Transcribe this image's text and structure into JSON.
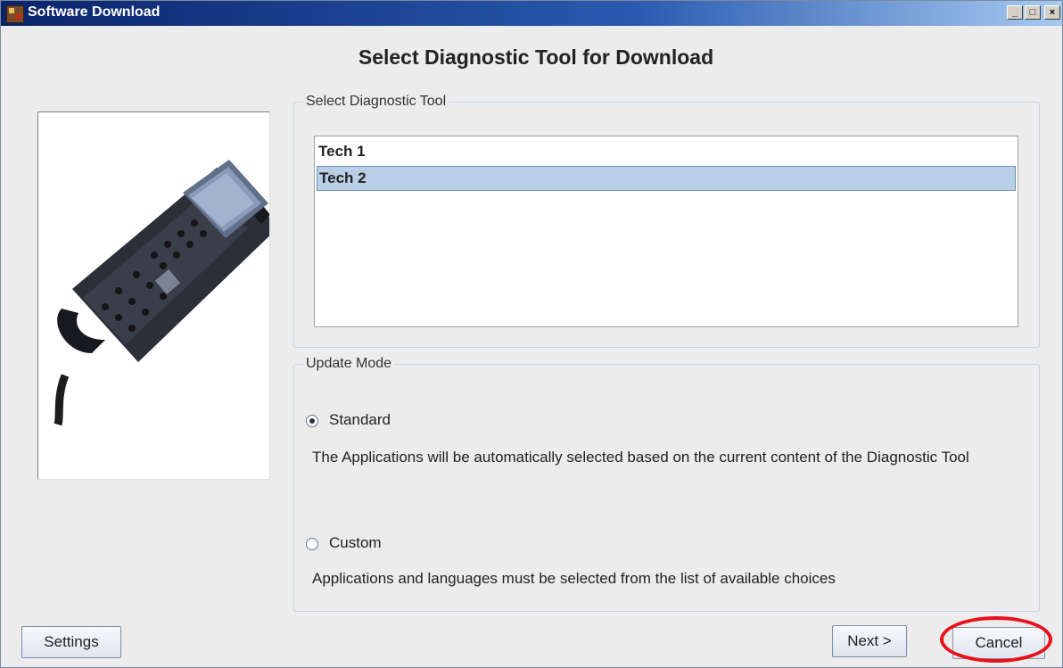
{
  "window": {
    "title": "Software Download",
    "controls": {
      "minimize": "_",
      "maximize": "□",
      "close": "×"
    }
  },
  "heading": "Select Diagnostic Tool for Download",
  "tool_group": {
    "title": "Select Diagnostic Tool",
    "items": [
      {
        "label": "Tech 1",
        "selected": false
      },
      {
        "label": "Tech 2",
        "selected": true
      }
    ]
  },
  "mode_group": {
    "title": "Update Mode",
    "standard": {
      "label": "Standard",
      "checked": true,
      "description": "The Applications will be automatically selected based on the current content of the Diagnostic Tool"
    },
    "custom": {
      "label": "Custom",
      "checked": false,
      "description": "Applications and languages must be selected from the list of available choices"
    }
  },
  "buttons": {
    "settings": "Settings",
    "next": "Next >",
    "cancel": "Cancel"
  },
  "colors": {
    "selection": "#b8cfe5",
    "annotation": "#e8101a"
  }
}
